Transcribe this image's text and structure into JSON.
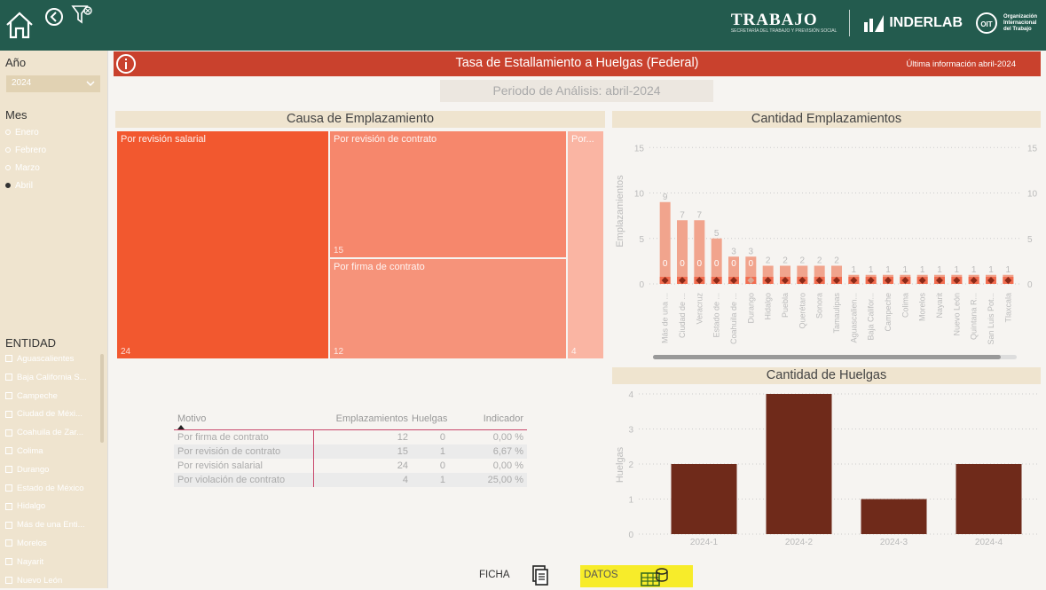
{
  "topbar": {
    "home_icon": "home-icon",
    "back_icon": "back-circle-icon",
    "filter_icon": "filter-clear-icon",
    "logo_trabajo": "TRABAJO",
    "logo_trabajo_sub": "SECRETARÍA DEL TRABAJO Y PREVISIÓN SOCIAL",
    "logo_inderlab": "INDERLAB",
    "logo_oit": "Organización Internacional del Trabajo"
  },
  "sidebar": {
    "year_label": "Año",
    "year_value": "2024",
    "month_label": "Mes",
    "months": [
      {
        "label": "Enero",
        "selected": false
      },
      {
        "label": "Febrero",
        "selected": false
      },
      {
        "label": "Marzo",
        "selected": false
      },
      {
        "label": "Abril",
        "selected": true
      }
    ],
    "entity_label": "ENTIDAD",
    "entities": [
      "Aguascalientes",
      "Baja California S...",
      "Campeche",
      "Ciudad de Méxi...",
      "Coahuila de Zar...",
      "Colima",
      "Durango",
      "Estado de México",
      "Hidalgo",
      "Más de una Enti...",
      "Morelos",
      "Nayarit",
      "Nuevo León"
    ]
  },
  "header": {
    "title": "Tasa de Estallamiento a Huelgas (Federal)",
    "update": "Última información abril-2024",
    "info_icon": "info-icon"
  },
  "period": "Periodo de Análisis: abril-2024",
  "treemap": {
    "title": "Causa de Emplazamiento",
    "tiles": [
      {
        "label": "Por revisión salarial",
        "value": "24"
      },
      {
        "label": "Por revisión de contrato",
        "value": "15"
      },
      {
        "label": "Por firma de contrato",
        "value": "12"
      },
      {
        "label": "Por...",
        "value": "4"
      }
    ]
  },
  "table": {
    "headers": [
      "Motivo",
      "Emplazamientos",
      "Huelgas",
      "Indicador"
    ],
    "rows": [
      [
        "Por firma de contrato",
        "12",
        "0",
        "0,00 %"
      ],
      [
        "Por revisión de contrato",
        "15",
        "1",
        "6,67 %"
      ],
      [
        "Por revisión salarial",
        "24",
        "0",
        "0,00 %"
      ],
      [
        "Por violación de contrato",
        "4",
        "1",
        "25,00 %"
      ]
    ]
  },
  "chart_data": [
    {
      "type": "bar",
      "title": "Cantidad Emplazamientos",
      "ylabel": "Emplazamientos",
      "ylim": [
        0,
        16
      ],
      "yticks": [
        0,
        5,
        10,
        15
      ],
      "categories": [
        "Más de una ...",
        "Ciudad de ...",
        "Veracruz",
        "Estado de ...",
        "Coahuila de ...",
        "Durango",
        "Hidalgo",
        "Puebla",
        "Querétaro",
        "Sonora",
        "Tamaulipas",
        "Aguascalien...",
        "Baja Califor...",
        "Campeche",
        "Colima",
        "Morelos",
        "Nayarit",
        "Nuevo León",
        "Quintana R...",
        "San Luis Pot...",
        "Tlaxcala"
      ],
      "values": [
        9,
        7,
        7,
        5,
        3,
        3,
        2,
        2,
        2,
        2,
        2,
        1,
        1,
        1,
        1,
        1,
        1,
        1,
        1,
        1,
        1
      ],
      "line_values": [
        0,
        0,
        0,
        0,
        0,
        0,
        0,
        0,
        0,
        0,
        0,
        0,
        0,
        0,
        0,
        0,
        0,
        0,
        0,
        0,
        0
      ],
      "line_labels": [
        "0",
        "0",
        "0",
        "0",
        "0",
        "0"
      ]
    },
    {
      "type": "bar",
      "title": "Cantidad de Huelgas",
      "ylabel": "Huelgas",
      "ylim": [
        0,
        4
      ],
      "yticks": [
        0,
        1,
        2,
        3,
        4
      ],
      "categories": [
        "2024-1",
        "2024-2",
        "2024-3",
        "2024-4"
      ],
      "values": [
        2,
        4,
        1,
        2
      ]
    }
  ],
  "footer": {
    "ficha": "FICHA",
    "datos": "DATOS",
    "doc_icon": "document-icon",
    "table_icon": "data-table-icon"
  },
  "colors": {
    "green": "#235b4e",
    "header": "#c9412d",
    "beige": "#efe4cf",
    "bar_light": "#f1a48d",
    "bar_dark": "#f26d50",
    "huelgas": "#6f2a1a",
    "marker": "#8a2a18",
    "highlight": "#f7ec2a"
  }
}
